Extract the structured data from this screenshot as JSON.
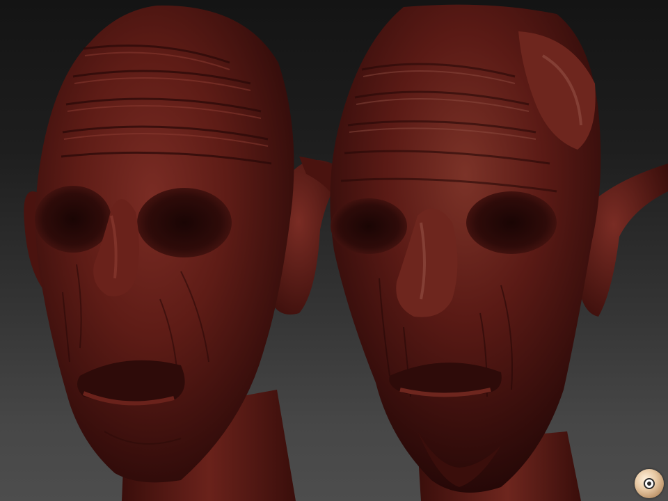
{
  "viewport": {
    "background_top": "#141414",
    "background_bottom": "#4d4d4d"
  },
  "models": [
    {
      "name": "left-head",
      "material_color": "#5e1c16",
      "highlight_color": "#8e3d33",
      "shadow_color": "#2a0908"
    },
    {
      "name": "right-head",
      "material_color": "#5a1a15",
      "highlight_color": "#925044",
      "shadow_color": "#260807"
    }
  ],
  "nav_widget": {
    "icon": "orbit-navigation-icon",
    "color": "#e8c9a4"
  }
}
